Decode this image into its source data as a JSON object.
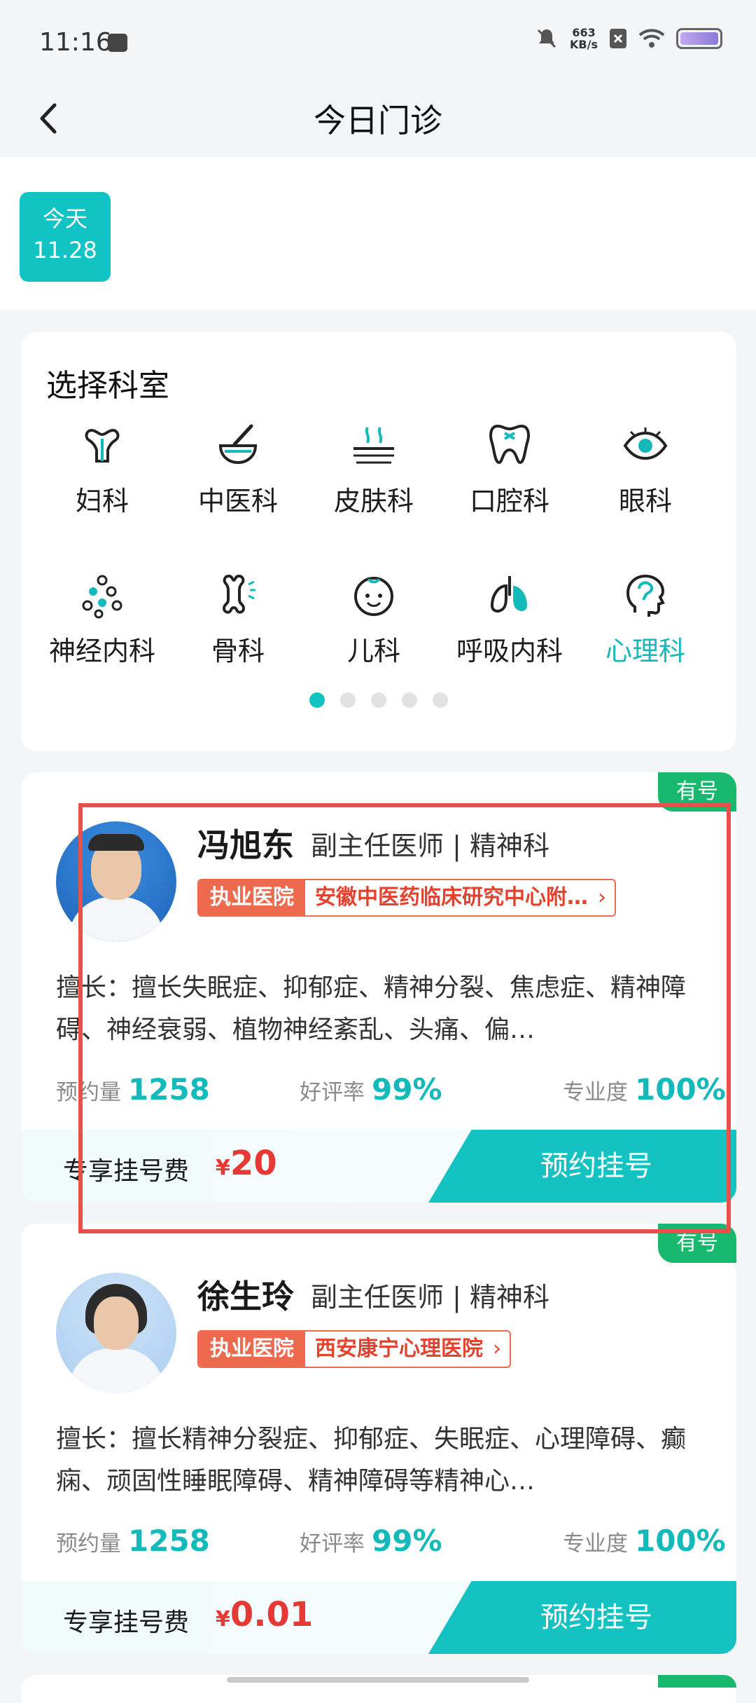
{
  "status_bar": {
    "time": "11:16",
    "speed_value": "663",
    "speed_unit": "KB/s"
  },
  "nav": {
    "title": "今日门诊"
  },
  "date": {
    "label": "今天",
    "value": "11.28"
  },
  "departments": {
    "title": "选择科室",
    "items": [
      {
        "label": "妇科",
        "icon": "uterus-icon"
      },
      {
        "label": "中医科",
        "icon": "mortar-pestle-icon"
      },
      {
        "label": "皮肤科",
        "icon": "skin-icon"
      },
      {
        "label": "口腔科",
        "icon": "tooth-icon"
      },
      {
        "label": "眼科",
        "icon": "eye-icon"
      },
      {
        "label": "神经内科",
        "icon": "neuron-icon"
      },
      {
        "label": "骨科",
        "icon": "bone-icon"
      },
      {
        "label": "儿科",
        "icon": "baby-face-icon"
      },
      {
        "label": "呼吸内科",
        "icon": "lungs-icon"
      },
      {
        "label": "心理科",
        "icon": "head-brain-icon"
      }
    ],
    "active_index": 9,
    "page_count": 5,
    "current_page": 0
  },
  "doctors": [
    {
      "badge": "有号",
      "name": "冯旭东",
      "title": "副主任医师 | 精神科",
      "hospital_tag": "执业医院",
      "hospital": "安徽中医药临床研究中心附…",
      "skill": "擅长：擅长失眠症、抑郁症、精神分裂、焦虑症、精神障碍、神经衰弱、植物神经紊乱、头痛、偏…",
      "stats": [
        {
          "label": "预约量",
          "value": "1258"
        },
        {
          "label": "好评率",
          "value": "99%"
        },
        {
          "label": "专业度",
          "value": "100%"
        }
      ],
      "fee_label": "专享挂号费",
      "currency": "¥",
      "fee": "20",
      "book_label": "预约挂号"
    },
    {
      "badge": "有号",
      "name": "徐生玲",
      "title": "副主任医师 | 精神科",
      "hospital_tag": "执业医院",
      "hospital": "西安康宁心理医院",
      "skill": "擅长：擅长精神分裂症、抑郁症、失眠症、心理障碍、癫痫、顽固性睡眠障碍、精神障碍等精神心…",
      "stats": [
        {
          "label": "预约量",
          "value": "1258"
        },
        {
          "label": "好评率",
          "value": "99%"
        },
        {
          "label": "专业度",
          "value": "100%"
        }
      ],
      "fee_label": "专享挂号费",
      "currency": "¥",
      "fee": "0.01",
      "book_label": "预约挂号"
    }
  ],
  "colors": {
    "accent": "#12c3c3",
    "badge_green": "#18b96e",
    "price_red": "#e53935",
    "tag_orange": "#ee6a4f",
    "highlight": "#e8504a"
  }
}
